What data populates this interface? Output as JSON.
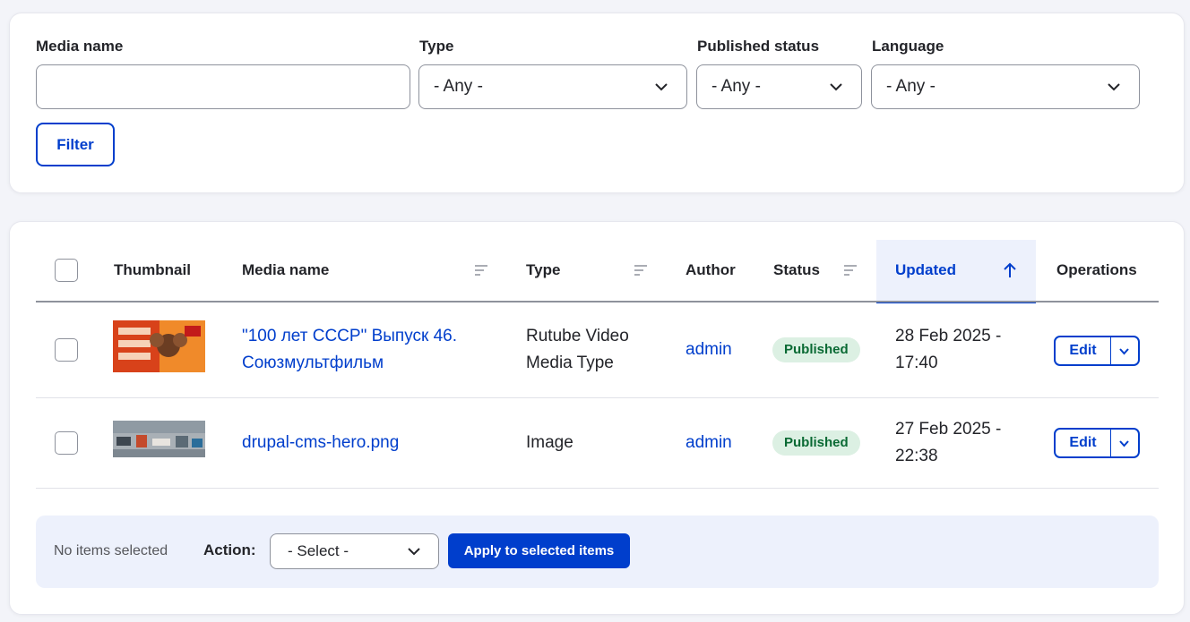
{
  "filters": {
    "media_name_label": "Media name",
    "media_name_value": "",
    "type_label": "Type",
    "type_value": "- Any -",
    "status_label": "Published status",
    "status_value": "- Any -",
    "language_label": "Language",
    "language_value": "- Any -",
    "filter_button": "Filter"
  },
  "table": {
    "headers": {
      "thumbnail": "Thumbnail",
      "media_name": "Media name",
      "type": "Type",
      "author": "Author",
      "status": "Status",
      "updated": "Updated",
      "operations": "Operations"
    },
    "rows": [
      {
        "media_name_line1": "\"100 лет СССР\" Выпуск 46.",
        "media_name_line2": "Союзмультфильм",
        "type_line1": "Rutube Video",
        "type_line2": "Media Type",
        "author": "admin",
        "status": "Published",
        "updated_line1": "28 Feb 2025 -",
        "updated_line2": "17:40",
        "edit": "Edit"
      },
      {
        "media_name_line1": "drupal-cms-hero.png",
        "type_line1": "Image",
        "author": "admin",
        "status": "Published",
        "updated_line1": "27 Feb 2025 -",
        "updated_line2": "22:38",
        "edit": "Edit"
      }
    ]
  },
  "bulk": {
    "selected_text": "No items selected",
    "action_label": "Action:",
    "action_value": "- Select -",
    "apply_button": "Apply to selected items"
  },
  "colors": {
    "accent": "#003ecc",
    "badge_bg": "#dcf0e3",
    "badge_text": "#0a6a34"
  }
}
